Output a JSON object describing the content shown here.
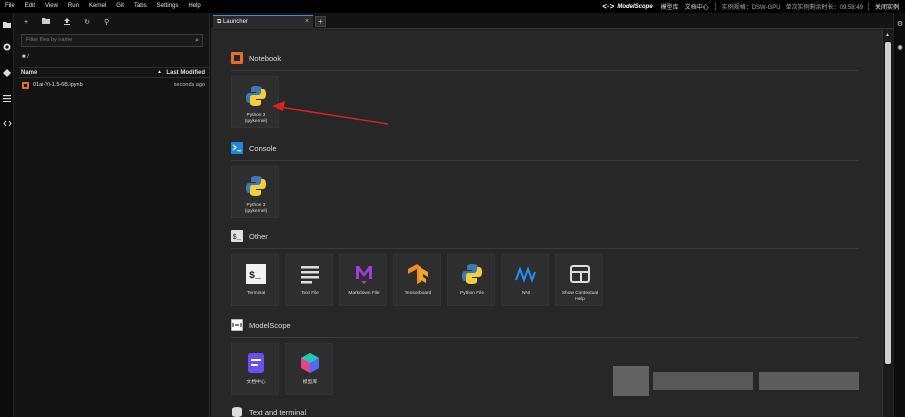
{
  "menubar": {
    "items": [
      "File",
      "Edit",
      "View",
      "Run",
      "Kernel",
      "Git",
      "Tabs",
      "Settings",
      "Help"
    ],
    "brand": "ModelScope",
    "links": [
      "模型库",
      "文档中心"
    ],
    "spec_label": "实例规格：",
    "spec_value": "DSW-GPU",
    "timer_label": "单次实例剩余时长：",
    "timer_value": "09:58:49",
    "close_instance": "关闭实例"
  },
  "filebrowser": {
    "search_placeholder": "Filter files by name",
    "breadcrumb": "/",
    "col_name": "Name",
    "col_modified": "Last Modified",
    "files": [
      {
        "name": "01ai-Yi-1.5-6B.ipynb",
        "modified": "seconds ago"
      }
    ]
  },
  "tabs": [
    {
      "label": "Launcher"
    }
  ],
  "launcher": {
    "sections": {
      "notebook": "Notebook",
      "console": "Console",
      "other": "Other",
      "modelscope": "ModelScope",
      "text_terminal": "Text and terminal"
    },
    "notebook_cards": [
      {
        "line1": "Python 3",
        "line2": "(ipykernel)"
      }
    ],
    "console_cards": [
      {
        "line1": "Python 3",
        "line2": "(ipykernel)"
      }
    ],
    "other_cards": [
      {
        "line1": "Terminal",
        "line2": ""
      },
      {
        "line1": "Text File",
        "line2": ""
      },
      {
        "line1": "Markdown File",
        "line2": ""
      },
      {
        "line1": "Tensorboard",
        "line2": ""
      },
      {
        "line1": "Python File",
        "line2": ""
      },
      {
        "line1": "NNI",
        "line2": ""
      },
      {
        "line1": "Show Contextual",
        "line2": "Help"
      }
    ],
    "modelscope_cards": [
      {
        "line1": "文档中心",
        "line2": ""
      },
      {
        "line1": "模型库",
        "line2": ""
      }
    ]
  },
  "colors": {
    "accent": "#4a8ad4",
    "notebook_orange": "#e46e2e",
    "console_blue": "#1e88e5",
    "arrow_red": "#e02020"
  }
}
